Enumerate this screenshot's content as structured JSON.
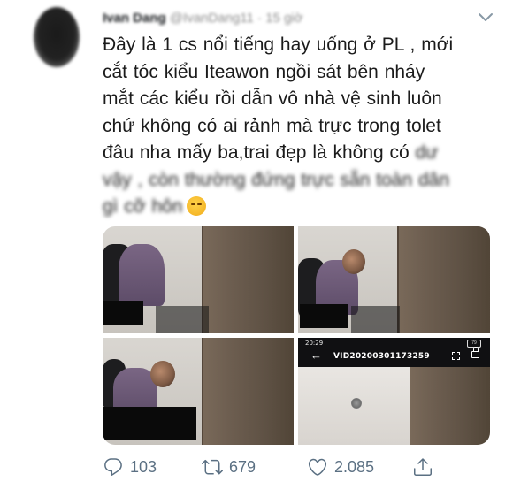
{
  "author": {
    "name": "Ivan Dang",
    "handle": "@IvanDang11",
    "separator": "·",
    "time": "15 giờ"
  },
  "tweet": {
    "lines": [
      "Đây là 1 cs nổi tiếng hay uống ở PL , mới",
      "cắt tóc kiểu Iteawon ngồi sát bên nháy",
      "mắt các kiểu rồi dẫn vô nhà vệ sinh luôn",
      "chứ không có ai rảnh mà trực trong tolet",
      "đâu nha mấy ba,trai đẹp là không có"
    ],
    "line5_blurred": "dư",
    "blurred_lines": [
      "vậy , còn thường đứng trực sẵn toàn dân",
      "gì cỡ hôn"
    ],
    "emoji": "sweat-smile-emoji"
  },
  "media": {
    "video_time": "20:29",
    "video_battery": "79",
    "video_back": "←",
    "video_title": "VID20200301173259"
  },
  "actions": {
    "reply_count": "103",
    "retweet_count": "679",
    "like_count": "2.085"
  },
  "icons": {
    "reply": "reply-icon",
    "retweet": "retweet-icon",
    "like": "heart-icon",
    "share": "share-icon",
    "caret": "chevron-down-icon"
  },
  "colors": {
    "text": "#14171a",
    "muted": "#5b7083",
    "background": "#ffffff"
  }
}
